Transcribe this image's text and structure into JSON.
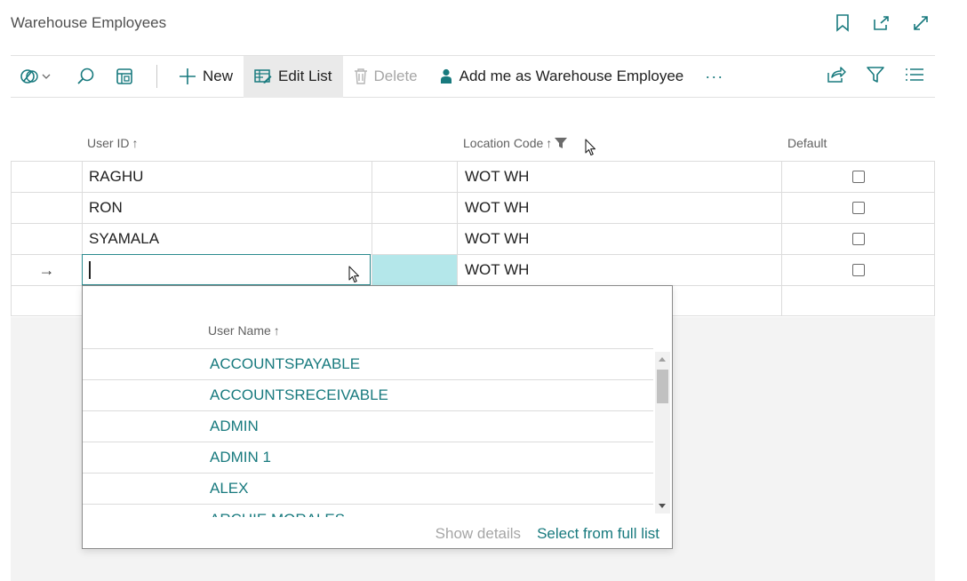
{
  "page": {
    "title": "Warehouse Employees"
  },
  "toolbar": {
    "new_label": "New",
    "edit_list_label": "Edit List",
    "delete_label": "Delete",
    "add_me_label": "Add me as Warehouse Employee",
    "more_label": "···"
  },
  "columns": {
    "user_id": "User ID",
    "location_code": "Location Code",
    "default": "Default",
    "sort_arrow": "↑"
  },
  "rows": [
    {
      "user_id": "RAGHU",
      "location_code": "WOT WH",
      "default": false
    },
    {
      "user_id": "RON",
      "location_code": "WOT WH",
      "default": false
    },
    {
      "user_id": "SYAMALA",
      "location_code": "WOT WH",
      "default": false
    },
    {
      "user_id": "",
      "location_code": "WOT WH",
      "default": false,
      "current_row_indicator": "→"
    }
  ],
  "lookup": {
    "header": "User Name",
    "items": [
      "ACCOUNTSPAYABLE",
      "ACCOUNTSRECEIVABLE",
      "ADMIN",
      "ADMIN 1",
      "ALEX",
      "ARCHIE MORALES"
    ],
    "show_details_label": "Show details",
    "select_full_list_label": "Select from full list"
  },
  "colors": {
    "accent": "#187a7e",
    "selection": "#b4e7ea"
  }
}
